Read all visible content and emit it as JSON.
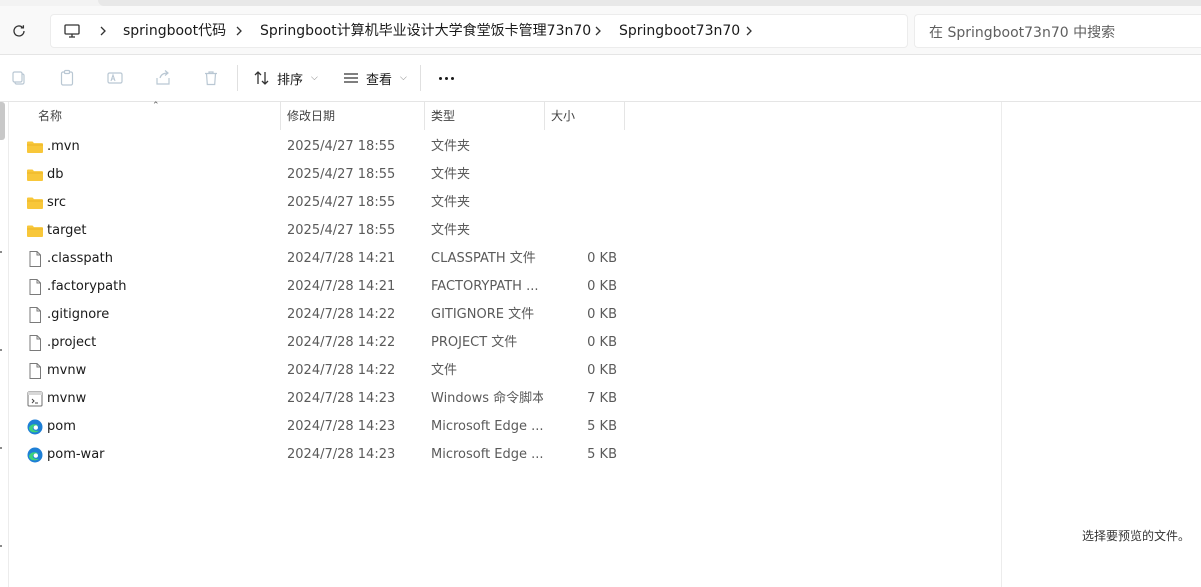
{
  "address": {
    "crumbs": [
      "springboot代码",
      "Springboot计算机毕业设计大学食堂饭卡管理73n70",
      "Springboot73n70"
    ]
  },
  "search": {
    "placeholder": "在 Springboot73n70 中搜索"
  },
  "toolbar": {
    "sort_label": "排序",
    "view_label": "查看",
    "icons": [
      "copy-icon",
      "paste-icon",
      "rename-icon",
      "share-icon",
      "delete-icon",
      "sort-icon",
      "view-icon",
      "more-icon"
    ]
  },
  "columns": {
    "name": "名称",
    "date": "修改日期",
    "type": "类型",
    "size": "大小"
  },
  "files": [
    {
      "name": ".mvn",
      "date": "2025/4/27 18:55",
      "type": "文件夹",
      "size": "",
      "icon": "folder-icon"
    },
    {
      "name": "db",
      "date": "2025/4/27 18:55",
      "type": "文件夹",
      "size": "",
      "icon": "folder-icon"
    },
    {
      "name": "src",
      "date": "2025/4/27 18:55",
      "type": "文件夹",
      "size": "",
      "icon": "folder-icon"
    },
    {
      "name": "target",
      "date": "2025/4/27 18:55",
      "type": "文件夹",
      "size": "",
      "icon": "folder-icon"
    },
    {
      "name": ".classpath",
      "date": "2024/7/28 14:21",
      "type": "CLASSPATH 文件",
      "size": "0 KB",
      "icon": "file-icon"
    },
    {
      "name": ".factorypath",
      "date": "2024/7/28 14:21",
      "type": "FACTORYPATH ...",
      "size": "0 KB",
      "icon": "file-icon"
    },
    {
      "name": ".gitignore",
      "date": "2024/7/28 14:22",
      "type": "GITIGNORE 文件",
      "size": "0 KB",
      "icon": "file-icon"
    },
    {
      "name": ".project",
      "date": "2024/7/28 14:22",
      "type": "PROJECT 文件",
      "size": "0 KB",
      "icon": "file-icon"
    },
    {
      "name": "mvnw",
      "date": "2024/7/28 14:22",
      "type": "文件",
      "size": "0 KB",
      "icon": "file-icon"
    },
    {
      "name": "mvnw",
      "date": "2024/7/28 14:23",
      "type": "Windows 命令脚本",
      "size": "7 KB",
      "icon": "script-icon"
    },
    {
      "name": "pom",
      "date": "2024/7/28 14:23",
      "type": "Microsoft Edge ...",
      "size": "5 KB",
      "icon": "edge-icon"
    },
    {
      "name": "pom-war",
      "date": "2024/7/28 14:23",
      "type": "Microsoft Edge ...",
      "size": "5 KB",
      "icon": "edge-icon"
    }
  ],
  "preview": {
    "message": "选择要预览的文件。"
  },
  "colors": {
    "folder": "#f8c73a",
    "edge": "#1e7fd6",
    "accent": "#0067c0"
  }
}
